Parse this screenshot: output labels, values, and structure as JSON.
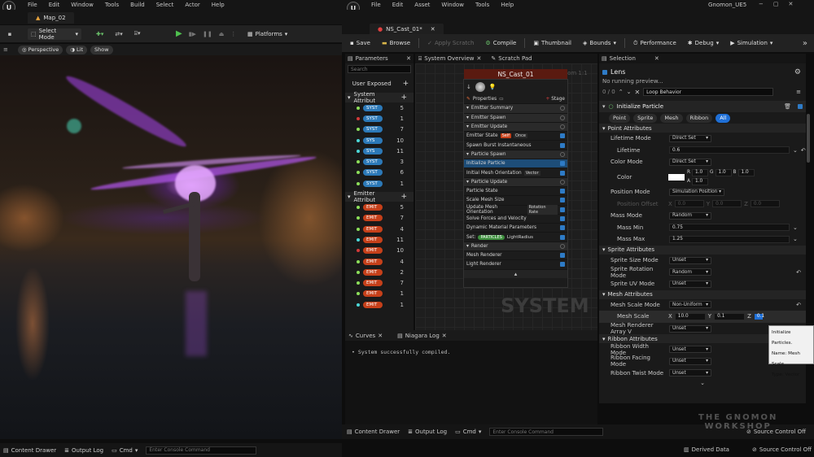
{
  "ue": {
    "menu": [
      "File",
      "Edit",
      "Window",
      "Tools",
      "Build",
      "Select",
      "Actor",
      "Help"
    ],
    "map_tab": "Map_02",
    "select_mode": "Select Mode",
    "platforms": "Platforms",
    "viewport": {
      "perspective": "Perspective",
      "lit": "Lit",
      "show": "Show"
    },
    "status": {
      "drawer": "Content Drawer",
      "output": "Output Log",
      "cmd": "Cmd",
      "console_placeholder": "Enter Console Command"
    }
  },
  "niagara": {
    "menu": [
      "File",
      "Edit",
      "Asset",
      "Window",
      "Tools",
      "Help"
    ],
    "project": "Gnomon_UE5",
    "asset_tab": "NS_Cast_01*",
    "toolbar": {
      "save": "Save",
      "browse": "Browse",
      "apply": "Apply Scratch",
      "compile": "Compile",
      "thumbnail": "Thumbnail",
      "bounds": "Bounds",
      "performance": "Performance",
      "debug": "Debug",
      "simulation": "Simulation"
    },
    "params": {
      "tab": "Parameters",
      "search": "Search",
      "user_exposed": "User Exposed",
      "system_attr": "System Attribut",
      "emitter_attr": "Emitter Attribut",
      "sys_rows": [
        {
          "label": "SYST",
          "n": "5",
          "c": "#8de05a"
        },
        {
          "label": "SYST",
          "n": "1",
          "c": "#d43a3a"
        },
        {
          "label": "SYST",
          "n": "7",
          "c": "#8de05a"
        },
        {
          "label": "SYS",
          "n": "10",
          "c": "#4cd9d9"
        },
        {
          "label": "SYS",
          "n": "11",
          "c": "#4cd9d9"
        },
        {
          "label": "SYST",
          "n": "3",
          "c": "#8de05a"
        },
        {
          "label": "SYST",
          "n": "6",
          "c": "#8de05a"
        },
        {
          "label": "SYST",
          "n": "1",
          "c": "#8de05a"
        }
      ],
      "emit_rows": [
        {
          "label": "EMIT",
          "n": "5",
          "c": "#8de05a"
        },
        {
          "label": "EMIT",
          "n": "7",
          "c": "#8de05a"
        },
        {
          "label": "EMIT",
          "n": "4",
          "c": "#8de05a"
        },
        {
          "label": "EMIT",
          "n": "11",
          "c": "#4cd9d9"
        },
        {
          "label": "EMIT",
          "n": "10",
          "c": "#d43a3a"
        },
        {
          "label": "EMIT",
          "n": "4",
          "c": "#8de05a"
        },
        {
          "label": "EMIT",
          "n": "2",
          "c": "#8de05a"
        },
        {
          "label": "EMIT",
          "n": "7",
          "c": "#8de05a"
        },
        {
          "label": "EMIT",
          "n": "1",
          "c": "#8de05a"
        },
        {
          "label": "EMIT",
          "n": "1",
          "c": "#4cd9d9"
        }
      ]
    },
    "graph_tabs": {
      "overview": "System Overview",
      "scratch": "Scratch Pad"
    },
    "node": {
      "title": "NS_Cast_01",
      "zoom": "Zoom 1:1",
      "properties": "Properties",
      "stage": "Stage",
      "watermark": "SYSTEM",
      "rows": [
        {
          "t": "Emitter Summary",
          "k": "hd"
        },
        {
          "t": "Emitter Spawn",
          "k": "hd"
        },
        {
          "t": "Emitter Update",
          "k": "hd"
        },
        {
          "t": "Emitter State",
          "k": "",
          "tag": "Self",
          "tag2": "Once"
        },
        {
          "t": "Spawn Burst Instantaneous",
          "k": ""
        },
        {
          "t": "Particle Spawn",
          "k": "hd"
        },
        {
          "t": "Initialize Particle",
          "k": "sel"
        },
        {
          "t": "Initial Mesh Orientation",
          "k": "",
          "tag2": "Vector"
        },
        {
          "t": "Particle Update",
          "k": "hd"
        },
        {
          "t": "Particle State",
          "k": ""
        },
        {
          "t": "Scale Mesh Size",
          "k": ""
        },
        {
          "t": "Update Mesh Orientation",
          "k": "",
          "tag2": "Rotation Rate"
        },
        {
          "t": "Solve Forces and Velocity",
          "k": ""
        },
        {
          "t": "Dynamic Material Parameters",
          "k": ""
        },
        {
          "t": "Set:",
          "k": "",
          "pill": "PARTICLES",
          "tag3": "LightRadius"
        },
        {
          "t": "Render",
          "k": "hd"
        },
        {
          "t": "Mesh Renderer",
          "k": ""
        },
        {
          "t": "Light Renderer",
          "k": ""
        }
      ]
    },
    "log": {
      "curves": "Curves",
      "niagara_log": "Niagara Log",
      "message": "• System successfully compiled."
    },
    "status": {
      "drawer": "Content Drawer",
      "output": "Output Log",
      "cmd": "Cmd",
      "console_placeholder": "Enter Console Command",
      "derived": "Derived Data",
      "source_control": "Source Control Off",
      "source_control2": "Source Control Off"
    },
    "selection": {
      "tab": "Selection",
      "lens": "Lens",
      "preview": "No running preview...",
      "counter": "0 / 0",
      "search_value": "Loop Behavior",
      "module": "Initialize Particle",
      "filter_tabs": [
        "Point",
        "Sprite",
        "Mesh",
        "Ribbon",
        "All"
      ],
      "point_attr": "Point Attributes",
      "lifetime_mode": "Lifetime Mode",
      "direct_set": "Direct Set",
      "lifetime": "Lifetime",
      "lifetime_v": "0.6",
      "color_mode": "Color Mode",
      "color": "Color",
      "r": "1.0",
      "g": "1.0",
      "b": "1.0",
      "a": "1.0",
      "position_mode": "Position Mode",
      "simulation_position": "Simulation Position",
      "position_offset": "Position Offset",
      "zero": "0.0",
      "mass_mode": "Mass Mode",
      "random": "Random",
      "mass_min": "Mass Min",
      "mass_min_v": "0.75",
      "mass_max": "Mass Max",
      "mass_max_v": "1.25",
      "sprite_attr": "Sprite Attributes",
      "sprite_size": "Sprite Size Mode",
      "unset": "Unset",
      "sprite_rot": "Sprite Rotation Mode",
      "sprite_uv": "Sprite UV Mode",
      "mesh_attr": "Mesh Attributes",
      "mesh_scale_mode": "Mesh Scale Mode",
      "non_uniform": "Non-Uniform",
      "mesh_scale": "Mesh Scale",
      "msx": "10.0",
      "msy": "0.1",
      "msz": "0.1",
      "mesh_arr": "Mesh Renderer Array V",
      "ribbon_attr": "Ribbon Attributes",
      "ribbon_width": "Ribbon Width Mode",
      "ribbon_facing": "Ribbon Facing Mode",
      "ribbon_twist": "Ribbon Twist Mode",
      "tooltip": [
        "Initialize Particles.",
        "Name: Mesh Scale",
        "Type: Vector"
      ]
    }
  },
  "branding": {
    "line1": "THE GNOMON",
    "line2": "WORKSHOP"
  }
}
